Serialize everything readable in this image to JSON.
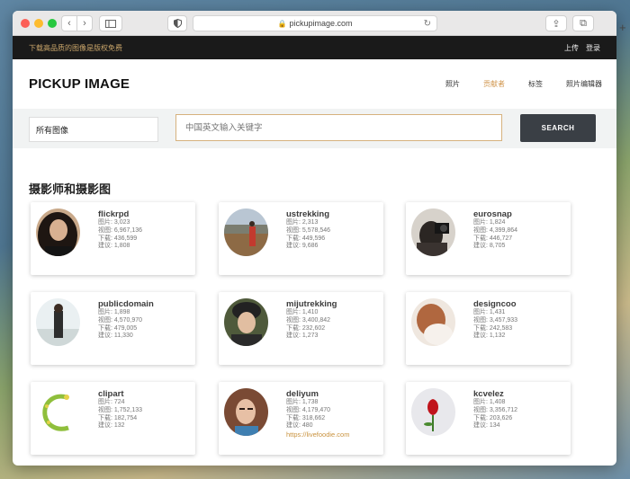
{
  "browser": {
    "url": "pickupimage.com"
  },
  "topbar": {
    "promo": "下载高品质的图像是版权免费",
    "upload": "上传",
    "login": "登录"
  },
  "header": {
    "logo": "PICKUP IMAGE",
    "menu": [
      "照片",
      "贡献者",
      "标签",
      "照片编辑器"
    ]
  },
  "search": {
    "category": "所有图像",
    "placeholder": "中国英文输入关键字",
    "button": "SEARCH"
  },
  "section_title": "摄影师和摄影图",
  "contributors": [
    {
      "name": "flickrpd",
      "photos": "图片: 3,023",
      "views": "视图: 6,967,136",
      "downloads": "下载: 436,599",
      "suggest": "建议: 1,808"
    },
    {
      "name": "ustrekking",
      "photos": "图片: 2,313",
      "views": "视图: 5,578,546",
      "downloads": "下载: 449,596",
      "suggest": "建议: 9,686"
    },
    {
      "name": "eurosnap",
      "photos": "图片: 1,824",
      "views": "视图: 4,399,864",
      "downloads": "下载: 446,727",
      "suggest": "建议: 8,705"
    },
    {
      "name": "publicdomain",
      "photos": "图片: 1,898",
      "views": "视图: 4,570,970",
      "downloads": "下载: 479,005",
      "suggest": "建议: 11,330"
    },
    {
      "name": "mijutrekking",
      "photos": "图片: 1,410",
      "views": "视图: 3,400,842",
      "downloads": "下载: 232,602",
      "suggest": "建议: 1,273"
    },
    {
      "name": "designcoo",
      "photos": "图片: 1,431",
      "views": "视图: 3,457,933",
      "downloads": "下载: 242,583",
      "suggest": "建议: 1,132"
    },
    {
      "name": "clipart",
      "photos": "图片: 724",
      "views": "视图: 1,752,133",
      "downloads": "下载: 182,754",
      "suggest": "建议: 132"
    },
    {
      "name": "deliyum",
      "photos": "图片: 1,738",
      "views": "视图: 4,179,470",
      "downloads": "下载: 318,662",
      "suggest": "建议: 480",
      "url": "https://livefoodie.com"
    },
    {
      "name": "kcvelez",
      "photos": "图片: 1,408",
      "views": "视图: 3,356,712",
      "downloads": "下载: 203,626",
      "suggest": "建议: 134"
    }
  ]
}
